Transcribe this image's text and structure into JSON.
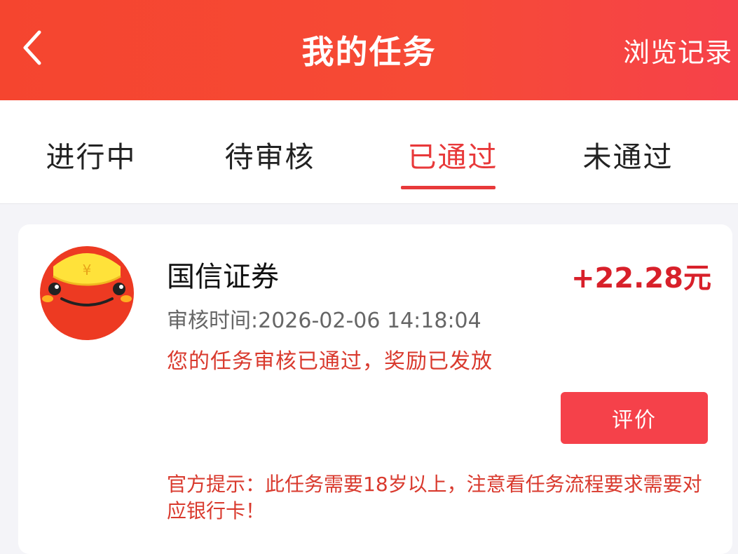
{
  "header": {
    "title": "我的任务",
    "history_label": "浏览记录",
    "back_icon": "chevron-left-icon"
  },
  "tabs": [
    {
      "label": "进行中",
      "active": false
    },
    {
      "label": "待审核",
      "active": false
    },
    {
      "label": "已通过",
      "active": true
    },
    {
      "label": "未通过",
      "active": false
    }
  ],
  "task": {
    "name": "国信证券",
    "reward": "+22.28元",
    "review_time": "审核时间:2026-02-06 14:18:04",
    "status": "您的任务审核已通过，奖励已发放",
    "rate_label": "评价",
    "notice": "官方提示：此任务需要18岁以上，注意看任务流程要求需要对应银行卡！",
    "avatar_icon": "red-envelope-mascot-icon"
  },
  "colors": {
    "header_bg": "#f5452f",
    "accent": "#e8393a",
    "reward": "#d8202a",
    "button": "#f5414a"
  }
}
